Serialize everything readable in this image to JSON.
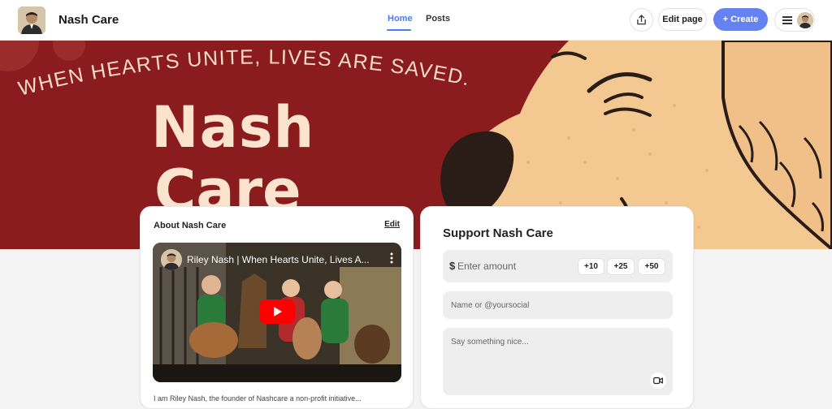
{
  "header": {
    "brand_name": "Nash Care",
    "tabs": [
      {
        "label": "Home",
        "active": true
      },
      {
        "label": "Posts",
        "active": false
      }
    ],
    "edit_page_label": "Edit page",
    "create_label": "+ Create",
    "accent_color": "#6482f0"
  },
  "hero": {
    "tagline": "WHEN HEARTS UNITE, LIVES ARE SAVED.",
    "title_line1": "Nash",
    "title_line2": "Care",
    "bg_color": "#8b1c1e",
    "dog_color": "#f3c891"
  },
  "about": {
    "title": "About Nash Care",
    "edit_label": "Edit",
    "video_title": "Riley Nash | When Hearts Unite, Lives A...",
    "description": "I am Riley Nash, the founder of Nashcare a non-profit initiative..."
  },
  "support": {
    "title": "Support Nash Care",
    "currency_symbol": "$",
    "amount_placeholder": "Enter amount",
    "quick_amounts": [
      "+10",
      "+25",
      "+50"
    ],
    "name_placeholder": "Name or @yoursocial",
    "message_placeholder": "Say something nice..."
  }
}
